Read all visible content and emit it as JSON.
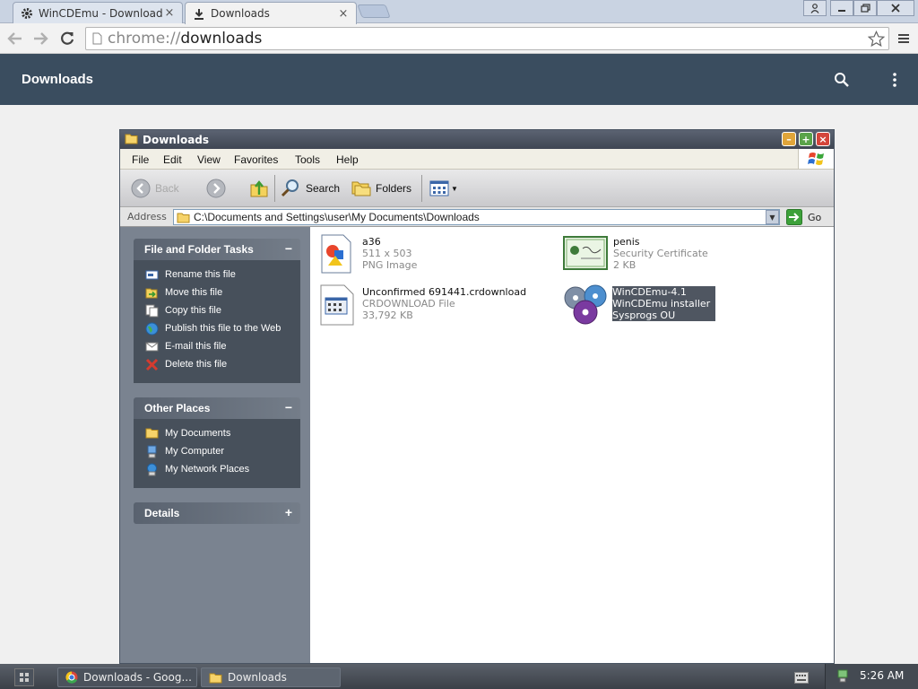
{
  "browser": {
    "tabs": [
      {
        "title": "WinCDEmu - Download",
        "close": "×"
      },
      {
        "title": "Downloads",
        "close": "×"
      }
    ],
    "url_scheme": "chrome://",
    "url_host": "downloads"
  },
  "downloads_page": {
    "title": "Downloads"
  },
  "explorer": {
    "title": "Downloads",
    "menu": [
      "File",
      "Edit",
      "View",
      "Favorites",
      "Tools",
      "Help"
    ],
    "toolbar": {
      "back": "Back",
      "search": "Search",
      "folders": "Folders"
    },
    "address_label": "Address",
    "address_path": "C:\\Documents and Settings\\user\\My Documents\\Downloads",
    "go_label": "Go",
    "panels": {
      "file_tasks": {
        "title": "File and Folder Tasks",
        "toggle": "−",
        "items": [
          "Rename this file",
          "Move this file",
          "Copy this file",
          "Publish this file to the Web",
          "E-mail this file",
          "Delete this file"
        ]
      },
      "other_places": {
        "title": "Other Places",
        "toggle": "−",
        "items": [
          "My Documents",
          "My Computer",
          "My Network Places"
        ]
      },
      "details": {
        "title": "Details",
        "toggle": "+"
      }
    },
    "files": [
      {
        "name": "a36",
        "line2": "511 x 503",
        "line3": "PNG Image"
      },
      {
        "name": "penis",
        "line2": "Security Certificate",
        "line3": "2 KB"
      },
      {
        "name": "Unconfirmed 691441.crdownload",
        "line2": "CRDOWNLOAD File",
        "line3": "33,792 KB"
      },
      {
        "name": "WinCDEmu-4.1",
        "line2": "WinCDEmu installer",
        "line3": "Sysprogs OU"
      }
    ]
  },
  "taskbar": {
    "items": [
      "Downloads - Goog...",
      "Downloads"
    ],
    "clock": "5:26 AM"
  }
}
